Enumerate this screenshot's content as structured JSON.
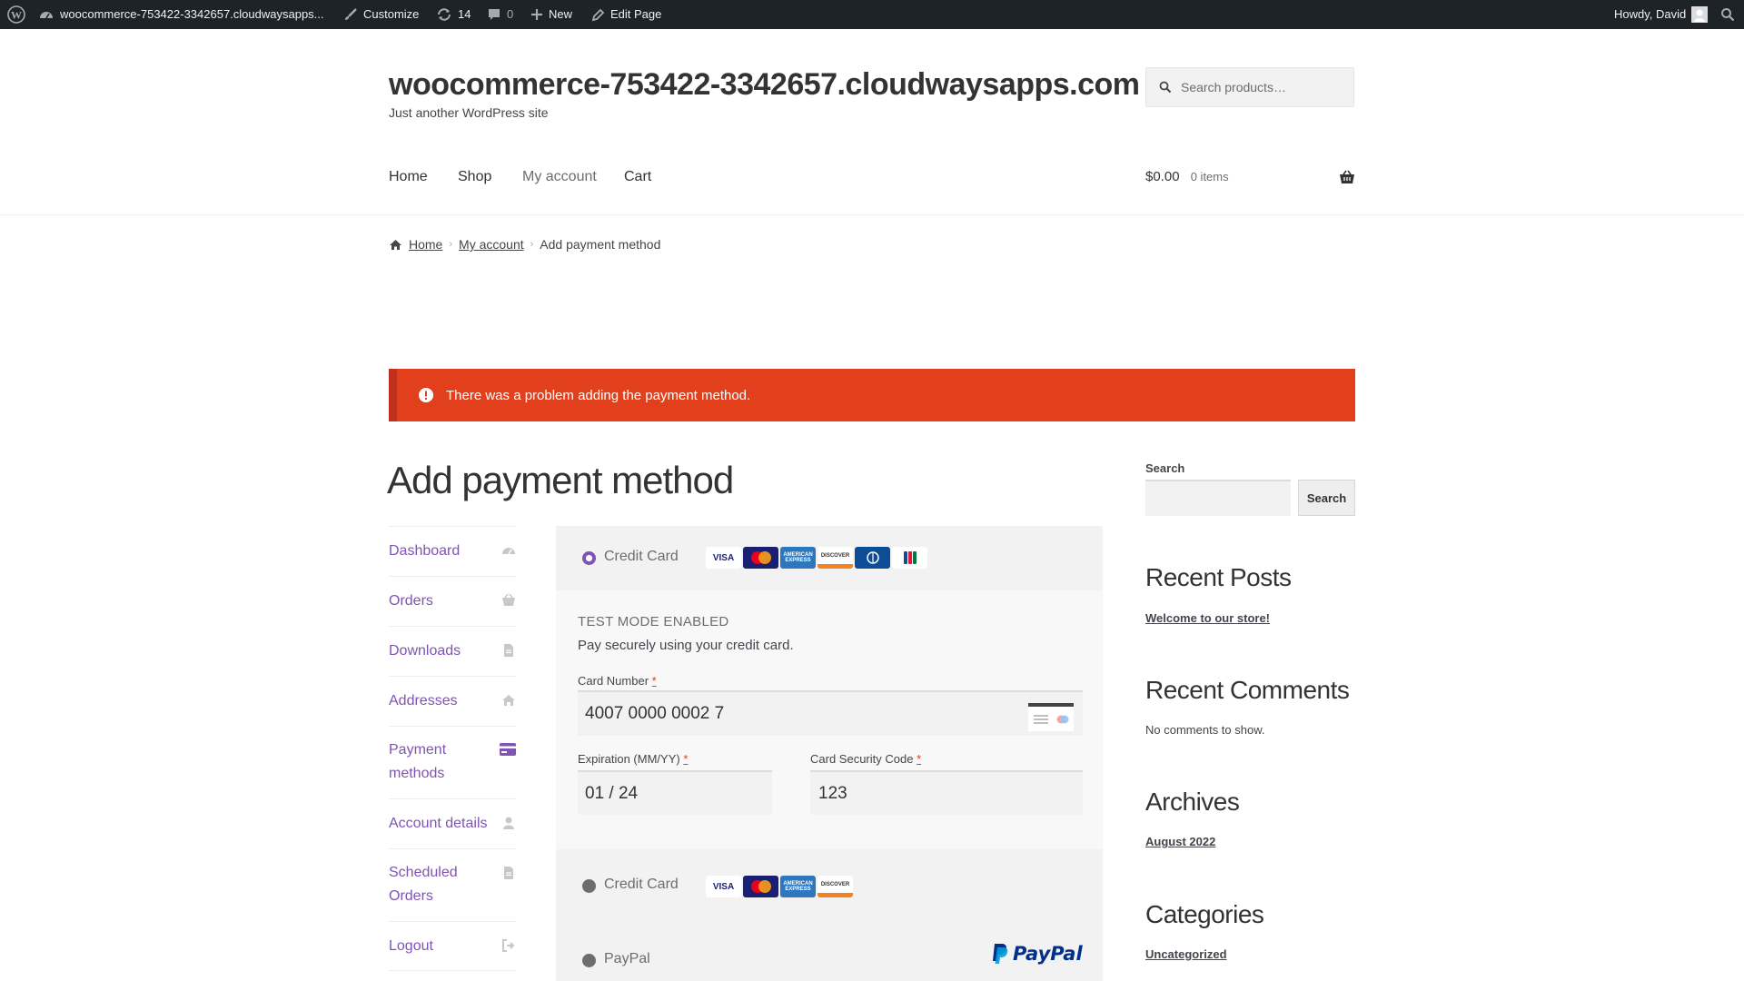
{
  "admin_bar": {
    "site_name": "woocommerce-753422-3342657.cloudwaysapps...",
    "customize": "Customize",
    "updates_count": "14",
    "comments_count": "0",
    "new": "New",
    "edit_page": "Edit Page",
    "greeting": "Howdy, David"
  },
  "header": {
    "site_title": "woocommerce-753422-3342657.cloudwaysapps.com",
    "tagline": "Just another WordPress site",
    "search_placeholder": "Search products…",
    "nav": [
      "Home",
      "Shop",
      "My account",
      "Cart"
    ],
    "cart_total": "$0.00",
    "cart_items": "0 items"
  },
  "breadcrumb": {
    "home": "Home",
    "account": "My account",
    "current": "Add payment method"
  },
  "error_notice": "There was a problem adding the payment method.",
  "page_title": "Add payment method",
  "account_menu": [
    {
      "label": "Dashboard",
      "icon": "dashboard-icon"
    },
    {
      "label": "Orders",
      "icon": "basket-icon"
    },
    {
      "label": "Downloads",
      "icon": "file-icon"
    },
    {
      "label": "Addresses",
      "icon": "home-icon"
    },
    {
      "label": "Payment methods",
      "icon": "credit-card-icon"
    },
    {
      "label": "Account details",
      "icon": "user-icon"
    },
    {
      "label": "Scheduled Orders",
      "icon": "file-icon"
    },
    {
      "label": "Logout",
      "icon": "logout-icon"
    }
  ],
  "payment": {
    "method1_label": "Credit Card",
    "method1_cards": [
      "VISA",
      "MC",
      "AMEX",
      "DISCOVER",
      "DINERS",
      "JCB"
    ],
    "test_mode": "TEST MODE ENABLED",
    "description": "Pay securely using your credit card.",
    "card_number_label": "Card Number",
    "card_number_value": "4007 0000 0002 7",
    "expiry_label": "Expiration (MM/YY)",
    "expiry_value": "01 / 24",
    "cvc_label": "Card Security Code",
    "cvc_value": "123",
    "required_mark": "*",
    "method2_label": "Credit Card",
    "method2_cards": [
      "VISA",
      "MC",
      "AMEX",
      "DISCOVER"
    ],
    "method3_label": "PayPal",
    "paypal_logo": "PayPal"
  },
  "sidebar": {
    "search_label": "Search",
    "search_button": "Search",
    "recent_posts_title": "Recent Posts",
    "recent_post": "Welcome to our store!",
    "recent_comments_title": "Recent Comments",
    "no_comments": "No comments to show.",
    "archives_title": "Archives",
    "archive_item": "August 2022",
    "categories_title": "Categories",
    "category_item": "Uncategorized"
  },
  "colors": {
    "accent": "#7f54b3",
    "error": "#e2401c",
    "admin_bar": "#1d2327"
  }
}
